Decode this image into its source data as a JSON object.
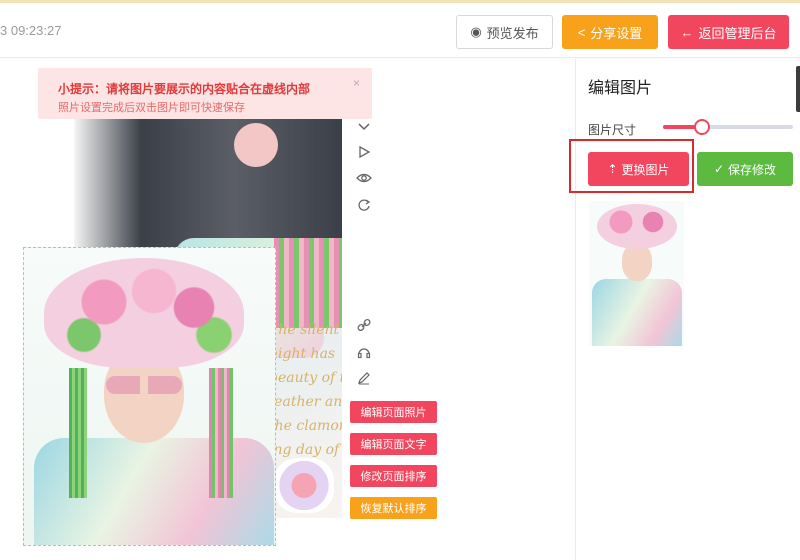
{
  "header": {
    "timestamp": "3 09:23:27",
    "buttons": {
      "preview": "预览发布",
      "share": "分享设置",
      "back": "返回管理后台"
    }
  },
  "tip": {
    "title": "小提示：请将图片要展示的内容贴合在虚线内部",
    "text": "照片设置完成后双击图片即可快速保存",
    "close": "×"
  },
  "poem": {
    "lines": [
      "The silent night has",
      "beauty of the",
      "feather and the clamor-",
      "ing day of the child"
    ]
  },
  "canvas_actions": {
    "edit_photo": "编辑页面照片",
    "edit_text": "编辑页面文字",
    "reorder": "修改页面排序",
    "reset_order": "恢复默认排序"
  },
  "panel": {
    "title": "编辑图片",
    "size_label": "图片尺寸",
    "size_value": 0.28,
    "replace_label": "更换图片",
    "save_label": "保存修改"
  },
  "colors": {
    "accent_red": "#f2465e",
    "accent_orange": "#f7a21a",
    "accent_green": "#5dba40"
  }
}
